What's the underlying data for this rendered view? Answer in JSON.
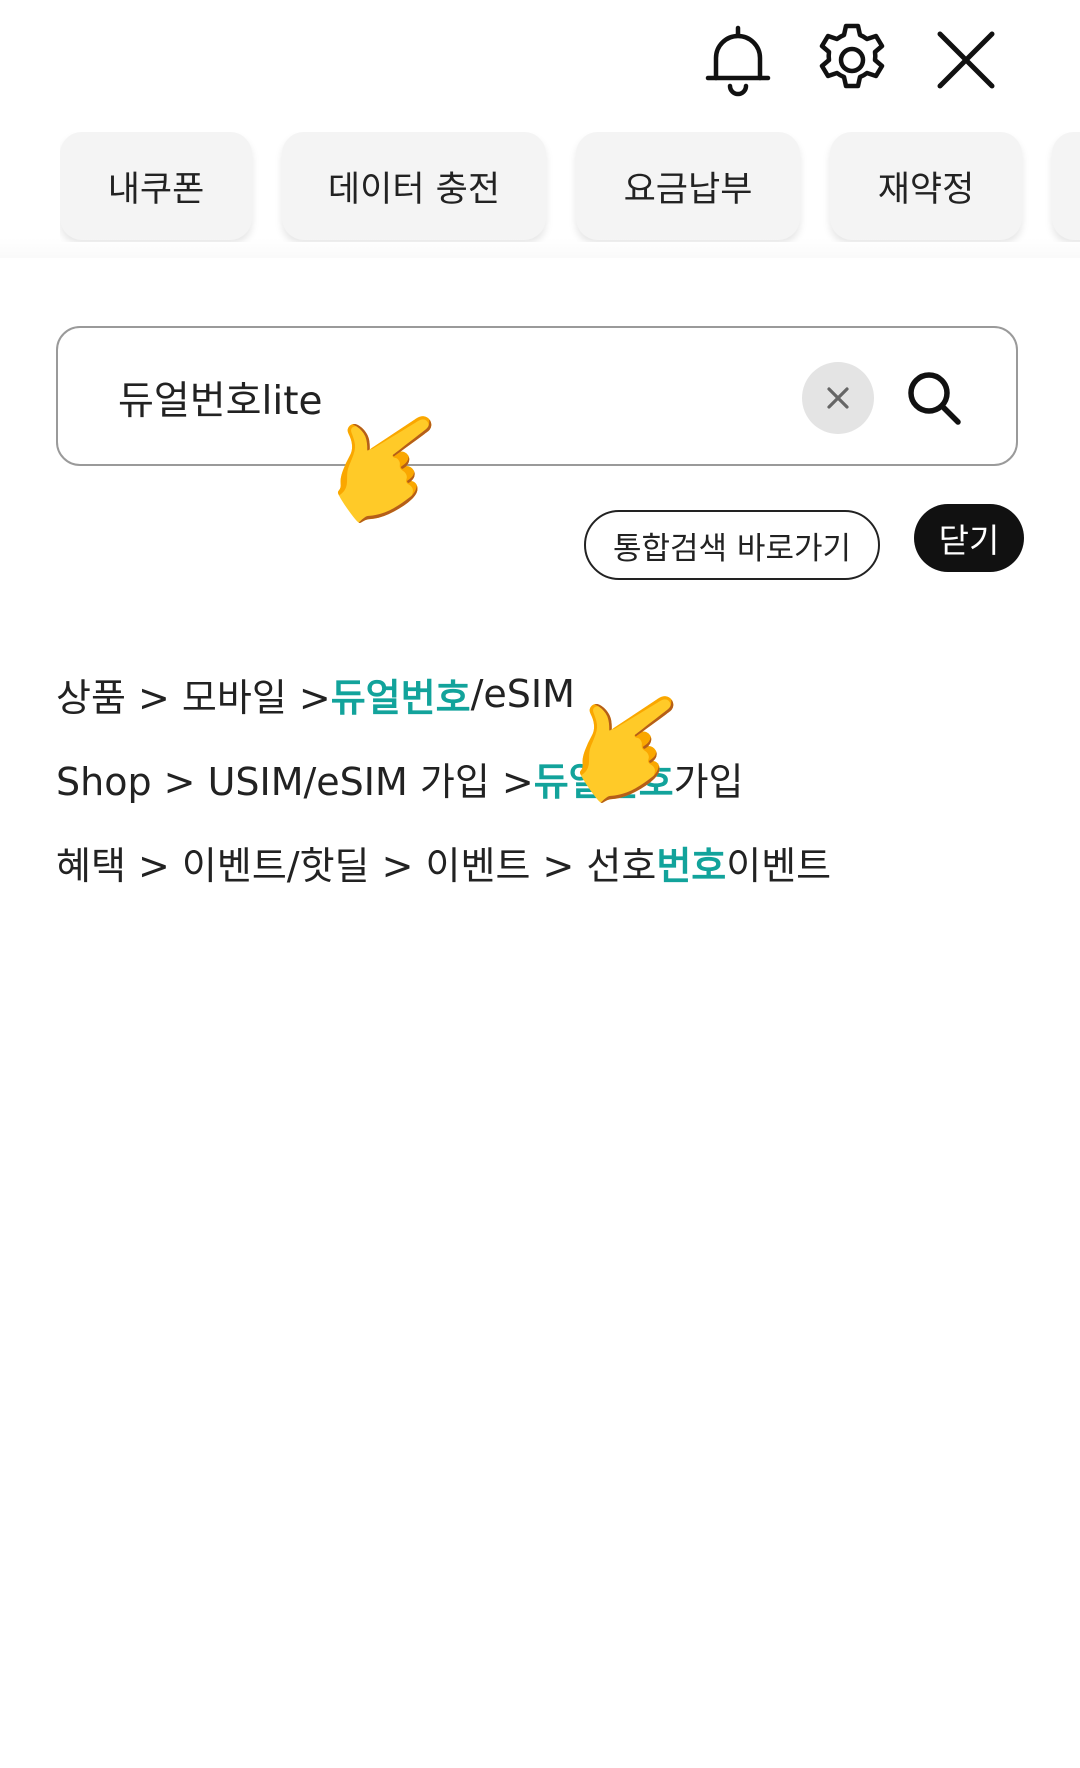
{
  "header": {
    "icons": [
      "bell-icon",
      "gear-icon",
      "close-icon"
    ]
  },
  "chips": [
    {
      "label": "내쿠폰"
    },
    {
      "label": "데이터 충전"
    },
    {
      "label": "요금납부"
    },
    {
      "label": "재약정"
    }
  ],
  "search": {
    "value": "듀얼번호lite",
    "clear_icon": "x-icon",
    "search_icon": "search-icon"
  },
  "actions": {
    "unified_search_label": "통합검색 바로가기",
    "close_label": "닫기"
  },
  "results": [
    {
      "parts": [
        {
          "text": "상품 > 모바일 > "
        },
        {
          "text": "듀얼번호",
          "hl": true
        },
        {
          "text": "/eSIM"
        }
      ]
    },
    {
      "parts": [
        {
          "text": "Shop > USIM/eSIM 가입 > "
        },
        {
          "text": "듀얼번호",
          "hl": true
        },
        {
          "text": " 가입"
        }
      ]
    },
    {
      "parts": [
        {
          "text": "혜택 > 이벤트/핫딜 > 이벤트 > 선호"
        },
        {
          "text": "번호",
          "hl": true
        },
        {
          "text": " 이벤트"
        }
      ]
    }
  ],
  "colors": {
    "highlight": "#12a39b",
    "close_button_bg": "#111111"
  },
  "overlay": {
    "pointer_emoji": "👉"
  }
}
